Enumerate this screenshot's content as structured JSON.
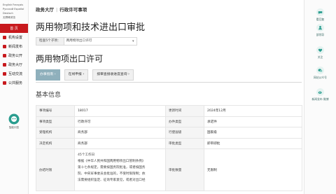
{
  "languages": [
    "English",
    "Français",
    "Pусский",
    "Español",
    "Deutsch",
    "无障碍浏览"
  ],
  "left_nav": [
    {
      "label": "首 页",
      "active": true
    },
    {
      "label": "机构设置",
      "active": false
    },
    {
      "label": "新闻发布",
      "active": false
    },
    {
      "label": "政务公开",
      "active": false
    },
    {
      "label": "政务大厅",
      "active": false
    },
    {
      "label": "互动交流",
      "active": false
    },
    {
      "label": "公共服务",
      "active": false
    }
  ],
  "side_logo_label": "智能问答",
  "right_nav": [
    {
      "label": "看回复",
      "icon": "reply-icon"
    },
    {
      "label": "部领导",
      "icon": "leader-icon"
    },
    {
      "label": "关注",
      "icon": "follow-icon"
    },
    {
      "label": "网站公众号",
      "icon": "wechat-icon"
    },
    {
      "label": "新闻发布 微博",
      "icon": "weibo-icon"
    }
  ],
  "breadcrumb": {
    "root": "政务大厅",
    "current": "行政许可事项"
  },
  "page_title": "两用物项和技术进出口审批",
  "category": {
    "label": "检查5个子项：",
    "selected": "两用物项出口许可"
  },
  "subitem_title": "两用物项出口许可",
  "buttons": {
    "guide": "办事指南",
    "online": "在线申报",
    "query": "按审查接收进度查询"
  },
  "section_title": "基本信息",
  "info_rows": [
    {
      "k1": "事项编号",
      "v1": "18017",
      "k2": "更新时间",
      "v2": "2024年12月"
    },
    {
      "k1": "事项类型",
      "v1": "行政许可",
      "k2": "办件类型",
      "v2": "承诺件"
    },
    {
      "k1": "受理机构",
      "v1": "商务部",
      "k2": "行使层级",
      "v2": "国家级"
    },
    {
      "k1": "决定机构",
      "v1": "商务部",
      "k2": "审批类型",
      "v2": "即审即批"
    }
  ],
  "timing_row": {
    "k1": "办结时限",
    "lines": [
      "45个工作日",
      "根据《中华人民共和国两用物项出口管制条例》",
      "第十七条规定，需要按国务院批准，或者按国务",
      "院、中央军事委员会批准的，不受时限限制；依",
      "法需要组织鉴定、征询专家意见，或者对出口经"
    ],
    "k2": "审批数量",
    "v2": "无限制"
  },
  "colors": {
    "brand_red": "#c8191d",
    "accent_blue": "#8fb0bc",
    "teal": "#2a9d8f"
  }
}
